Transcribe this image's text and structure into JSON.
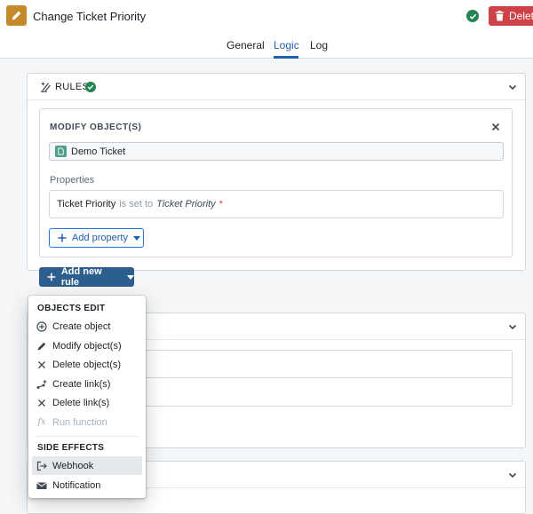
{
  "header": {
    "title": "Change Ticket Priority",
    "delete_label": "Delete"
  },
  "tabs": [
    {
      "label": "General",
      "active": false
    },
    {
      "label": "Logic",
      "active": true
    },
    {
      "label": "Log",
      "active": false
    }
  ],
  "rules": {
    "title": "RULES",
    "modify": {
      "title": "MODIFY OBJECT(S)",
      "object_label": "Demo Ticket",
      "properties_label": "Properties",
      "property": {
        "name": "Ticket Priority",
        "connector": "is set to",
        "value": "Ticket Priority",
        "required_mark": "*"
      },
      "add_property_label": "Add property"
    },
    "add_rule_label": "Add new rule"
  },
  "menu": {
    "objects_header": "OBJECTS EDIT",
    "objects_items": [
      {
        "label": "Create object",
        "icon": "plus-circle-icon",
        "disabled": false
      },
      {
        "label": "Modify object(s)",
        "icon": "edit-pencil-icon",
        "disabled": false
      },
      {
        "label": "Delete object(s)",
        "icon": "cross-icon",
        "disabled": false
      },
      {
        "label": "Create link(s)",
        "icon": "link-icon",
        "disabled": false
      },
      {
        "label": "Delete link(s)",
        "icon": "cross-icon",
        "disabled": false
      },
      {
        "label": "Run function",
        "icon": "function-icon",
        "disabled": true
      }
    ],
    "side_header": "SIDE EFFECTS",
    "side_items": [
      {
        "label": "Webhook",
        "icon": "export-icon",
        "hovered": true
      },
      {
        "label": "Notification",
        "icon": "envelope-icon",
        "hovered": false
      }
    ]
  },
  "colors": {
    "accent": "#215db0",
    "primary_button": "#2d5f8e",
    "danger": "#cd4246",
    "success": "#238551",
    "app_icon": "#c48a2b"
  }
}
